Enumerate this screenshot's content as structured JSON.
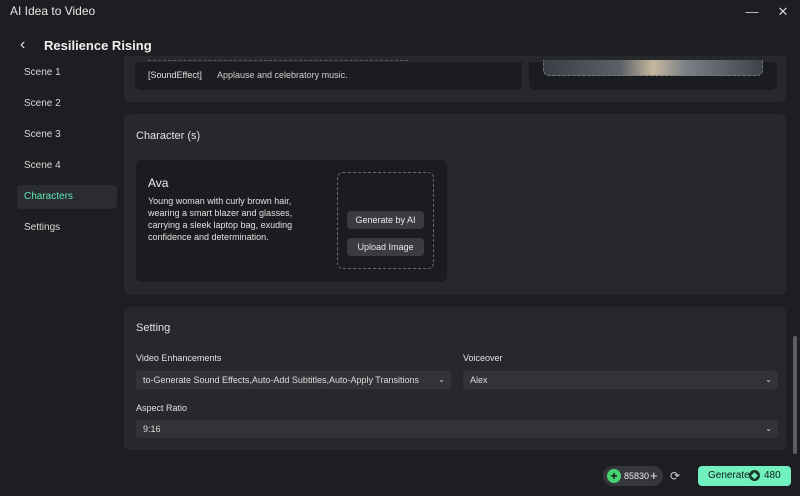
{
  "app": {
    "title": "AI Idea to Video",
    "minimize_glyph": "—",
    "close_glyph": "✕"
  },
  "header": {
    "title": "Resilience Rising",
    "back_icon": "chevron-left-icon"
  },
  "sidebar": {
    "items": [
      {
        "label": "Scene 1"
      },
      {
        "label": "Scene 2"
      },
      {
        "label": "Scene 3"
      },
      {
        "label": "Scene 4"
      },
      {
        "label": "Characters",
        "active": true
      },
      {
        "label": "Settings"
      }
    ]
  },
  "scene": {
    "sound_effect_label": "[SoundEffect]",
    "sound_effect_text": "Applause and celebratory music."
  },
  "characters": {
    "section_title": "Character (s)",
    "items": [
      {
        "name": "Ava",
        "description": "Young woman with curly brown hair, wearing a smart blazer and glasses, carrying a sleek laptop bag, exuding confidence and determination.",
        "generate_label": "Generate by AI",
        "upload_label": "Upload Image"
      }
    ]
  },
  "setting": {
    "section_title": "Setting",
    "video_enhancements": {
      "label": "Video Enhancements",
      "value": "to-Generate Sound Effects,Auto-Add Subtitles,Auto-Apply Transitions"
    },
    "voiceover": {
      "label": "Voiceover",
      "value": "Alex"
    },
    "aspect_ratio": {
      "label": "Aspect Ratio",
      "value": "9:16"
    }
  },
  "footer": {
    "credits": "85830",
    "generate_label": "Generate",
    "generate_cost": "480"
  },
  "colors": {
    "accent": "#72f0c0",
    "active_text": "#5ee8b8",
    "panel": "#26282b",
    "background": "#1d1e21"
  }
}
